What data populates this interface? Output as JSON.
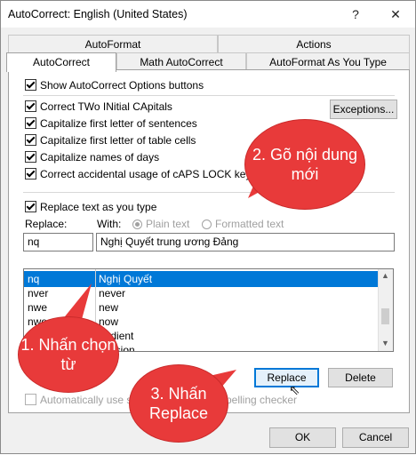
{
  "window": {
    "title": "AutoCorrect: English (United States)",
    "help_label": "?",
    "close_label": "✕"
  },
  "tabs": {
    "row1": [
      {
        "label": "AutoFormat"
      },
      {
        "label": "Actions"
      }
    ],
    "row2": [
      {
        "label": "AutoCorrect",
        "active": true
      },
      {
        "label": "Math AutoCorrect"
      },
      {
        "label": "AutoFormat As You Type"
      }
    ]
  },
  "options": {
    "show_options_buttons": {
      "label": "Show AutoCorrect Options buttons",
      "checked": true
    },
    "two_initial_caps": {
      "label": "Correct TWo INitial CApitals",
      "checked": true
    },
    "first_letter_sentences": {
      "label": "Capitalize first letter of sentences",
      "checked": true
    },
    "first_letter_table_cells": {
      "label": "Capitalize first letter of table cells",
      "checked": true
    },
    "names_of_days": {
      "label": "Capitalize names of days",
      "checked": true
    },
    "caps_lock": {
      "label": "Correct accidental usage of cAPS LOCK key",
      "checked": true
    },
    "exceptions_label": "Exceptions...",
    "replace_as_you_type": {
      "label": "Replace text as you type",
      "checked": true
    }
  },
  "replace": {
    "replace_label": "Replace:",
    "with_label": "With:",
    "plain_text_label": "Plain text",
    "formatted_text_label": "Formatted text",
    "replace_value": "nq",
    "with_value": "Nghị Quyết trung ương Đảng"
  },
  "list": {
    "rows": [
      {
        "key": "nq",
        "value": "Nghị Quyết",
        "selected": true
      },
      {
        "key": "nver",
        "value": "never"
      },
      {
        "key": "nwe",
        "value": "new"
      },
      {
        "key": "nwo",
        "value": "now"
      },
      {
        "key": "o",
        "value": "bedient"
      },
      {
        "key": "o",
        "value": "ccasion"
      }
    ]
  },
  "buttons": {
    "replace_label": "Replace",
    "delete_label": "Delete",
    "ok_label": "OK",
    "cancel_label": "Cancel"
  },
  "auto_suggestions": {
    "part1": "Automatically use s",
    "part2": "spelling checker"
  },
  "callouts": {
    "c1": "1. Nhấn chọn từ",
    "c2": "2. Gõ nội dung mới",
    "c3": "3. Nhấn Replace"
  },
  "colors": {
    "callout": "#e83a3a",
    "selection": "#0078d7"
  }
}
